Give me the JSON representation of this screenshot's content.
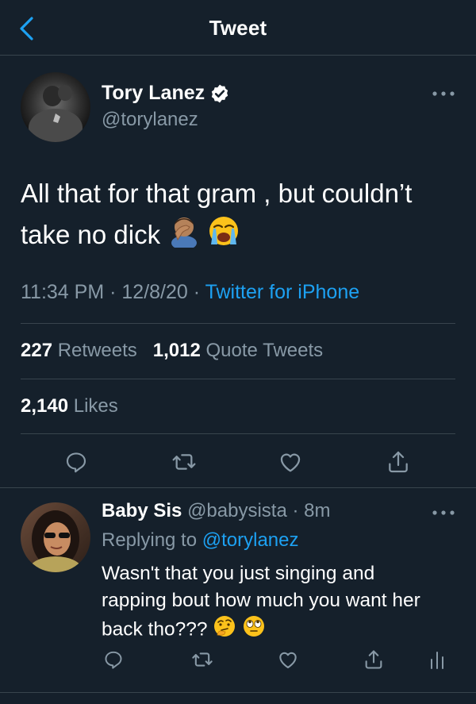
{
  "header": {
    "title": "Tweet"
  },
  "tweet": {
    "author_name": "Tory Lanez",
    "author_handle": "@torylanez",
    "text_line1": "All that for that gram , but couldn’t",
    "text_line2": "take no dick",
    "time": "11:34 PM",
    "date": "12/8/20",
    "source": "Twitter for iPhone",
    "retweets_count": "227",
    "retweets_label": "Retweets",
    "quotes_count": "1,012",
    "quotes_label": "Quote Tweets",
    "likes_count": "2,140",
    "likes_label": "Likes"
  },
  "reply": {
    "name": "Baby Sis",
    "handle": "@babysista",
    "time": "8m",
    "replying_prefix": "Replying to",
    "replying_to": "@torylanez",
    "text_line1": "Wasn't that you just singing and",
    "text_line2": "rapping bout how much you want her",
    "text_line3": "back tho???"
  },
  "colors": {
    "background": "#15202b",
    "accent": "#1da1f2",
    "muted": "#8899a6",
    "divider": "#38444d"
  }
}
